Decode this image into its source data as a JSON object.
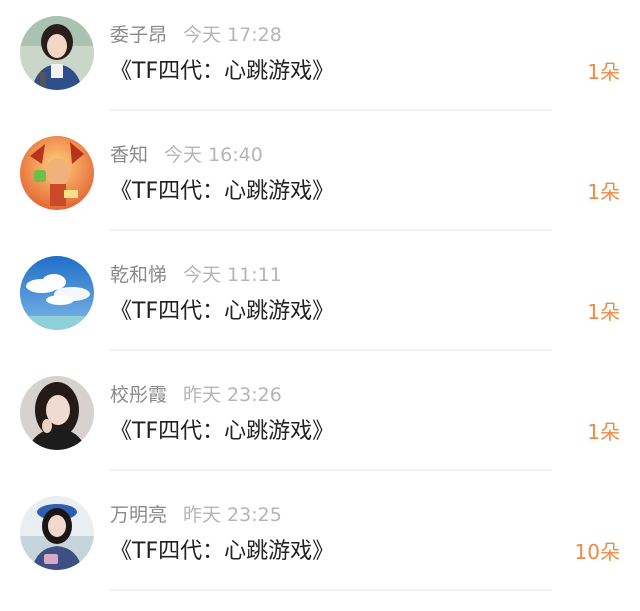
{
  "accent_color": "#ef8a42",
  "items": [
    {
      "name": "委子昂",
      "time": "今天 17:28",
      "title": "《TF四代：心跳游戏》",
      "count": "1朵",
      "avatar_icon": "girl-portrait-avatar"
    },
    {
      "name": "香知",
      "time": "今天 16:40",
      "title": "《TF四代：心跳游戏》",
      "count": "1朵",
      "avatar_icon": "game-character-avatar"
    },
    {
      "name": "乾和悌",
      "time": "今天 11:11",
      "title": "《TF四代：心跳游戏》",
      "count": "1朵",
      "avatar_icon": "blue-sky-clouds-avatar"
    },
    {
      "name": "校彤霞",
      "time": "昨天 23:26",
      "title": "《TF四代：心跳游戏》",
      "count": "1朵",
      "avatar_icon": "woman-portrait-avatar"
    },
    {
      "name": "万明亮",
      "time": "昨天 23:25",
      "title": "《TF四代：心跳游戏》",
      "count": "10朵",
      "avatar_icon": "girl-blue-hat-avatar"
    }
  ]
}
